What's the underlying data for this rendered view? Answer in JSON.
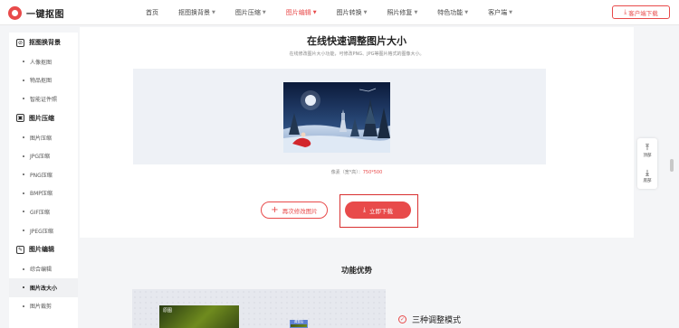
{
  "header": {
    "logo_text": "一键抠图",
    "nav": [
      {
        "label": "首页",
        "has_dropdown": false,
        "active": false
      },
      {
        "label": "抠图换背景",
        "has_dropdown": true,
        "active": false
      },
      {
        "label": "图片压缩",
        "has_dropdown": true,
        "active": false
      },
      {
        "label": "图片编辑",
        "has_dropdown": true,
        "active": true
      },
      {
        "label": "图片转换",
        "has_dropdown": true,
        "active": false
      },
      {
        "label": "照片修复",
        "has_dropdown": true,
        "active": false
      },
      {
        "label": "特色功能",
        "has_dropdown": true,
        "active": false
      },
      {
        "label": "客户端",
        "has_dropdown": true,
        "active": false
      }
    ],
    "download_button": "客户端下载"
  },
  "sidebar": {
    "groups": [
      {
        "label": "抠图换背景",
        "icon": "cutout-icon",
        "items": [
          "人像抠图",
          "物品抠图",
          "智能证件照"
        ]
      },
      {
        "label": "图片压缩",
        "icon": "compress-icon",
        "items": [
          "图片压缩",
          "JPG压缩",
          "PNG压缩",
          "BMP压缩",
          "GIF压缩",
          "JPEG压缩"
        ]
      },
      {
        "label": "图片编辑",
        "icon": "edit-icon",
        "items": [
          "综合编辑",
          "图片改大小",
          "图片裁剪"
        ]
      }
    ],
    "active_item": "图片改大小"
  },
  "main": {
    "title": "在线快速调整图片大小",
    "subtitle": "在线修改图片大小功能，可修改PNG、JPG等图片格式的图像大小。",
    "size_label": "像素（宽*高）：",
    "size_value": "750*500",
    "redo_button": "再次修改图片",
    "download_button": "立即下载"
  },
  "float_bar": {
    "top_label": "顶部",
    "bottom_label": "底部"
  },
  "advantages": {
    "title": "功能优势",
    "original_label": "原图",
    "adjusted_label": "调整后",
    "feature_1": "三种调整模式"
  },
  "colors": {
    "accent": "#e84a4a",
    "highlight_border": "#d93030",
    "page_bg": "#f4f5f7"
  }
}
